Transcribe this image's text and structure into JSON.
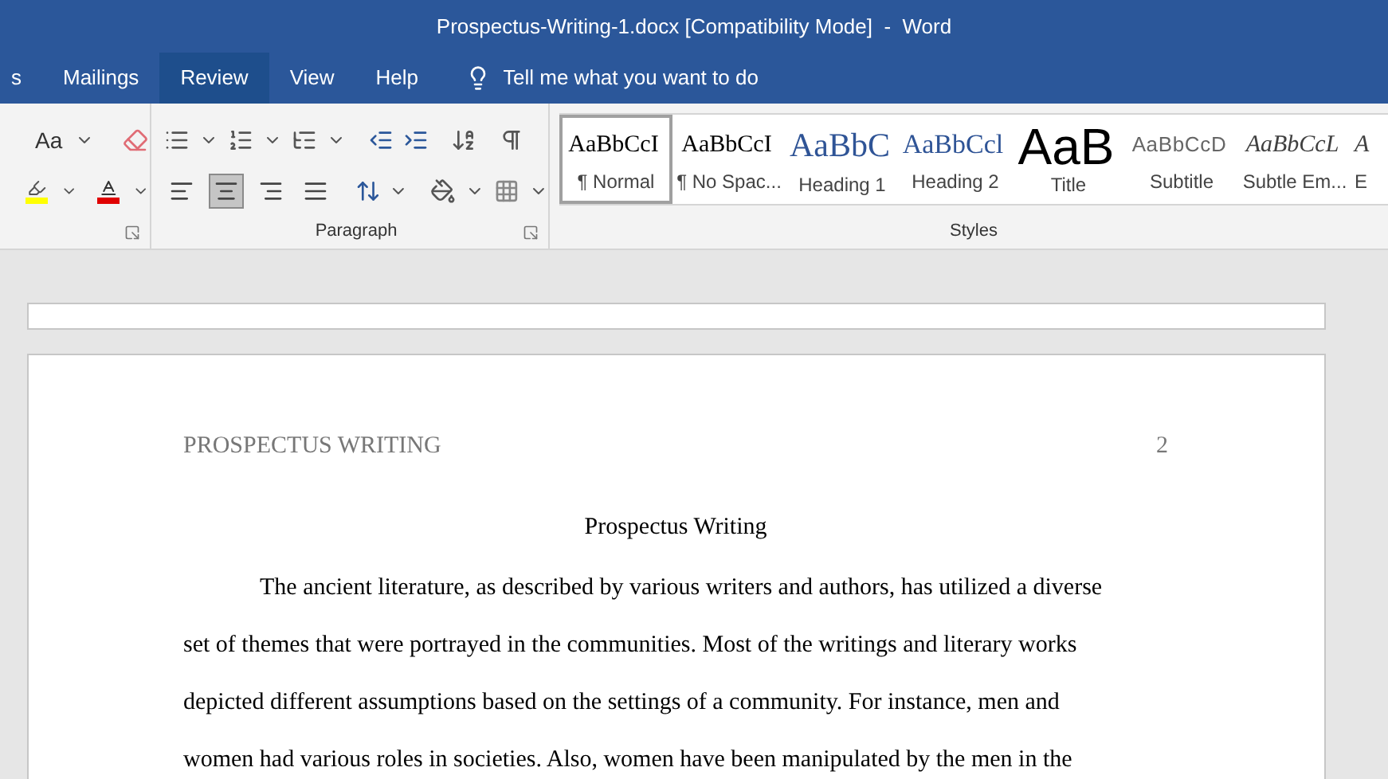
{
  "window": {
    "title": "Prospectus-Writing-1.docx [Compatibility Mode]  -  Word"
  },
  "tabs": [
    {
      "label": "s",
      "selected": false
    },
    {
      "label": "Mailings",
      "selected": false
    },
    {
      "label": "Review",
      "selected": true
    },
    {
      "label": "View",
      "selected": false
    },
    {
      "label": "Help",
      "selected": false
    }
  ],
  "tell_me": {
    "placeholder": "Tell me what you want to do"
  },
  "font_group": {
    "change_case": "Aa"
  },
  "paragraph_group": {
    "label": "Paragraph",
    "alignments": [
      {
        "kind": "left",
        "selected": false
      },
      {
        "kind": "center",
        "selected": true
      },
      {
        "kind": "right",
        "selected": false
      },
      {
        "kind": "justify",
        "selected": false
      }
    ]
  },
  "styles_group": {
    "label": "Styles",
    "styles": [
      {
        "preview": "AaBbCcI",
        "label": "¶ Normal",
        "kind": "normal",
        "selected": true
      },
      {
        "preview": "AaBbCcI",
        "label": "¶ No Spac...",
        "kind": "normal",
        "selected": false
      },
      {
        "preview": "AaBbC",
        "label": "Heading 1",
        "kind": "heading1",
        "selected": false
      },
      {
        "preview": "AaBbCcl",
        "label": "Heading 2",
        "kind": "heading2",
        "selected": false
      },
      {
        "preview": "AaB",
        "label": "Title",
        "kind": "title",
        "selected": false
      },
      {
        "preview": "AaBbCcD",
        "label": "Subtitle",
        "kind": "subtitle",
        "selected": false
      },
      {
        "preview": "AaBbCcL",
        "label": "Subtle Em...",
        "kind": "emphasis",
        "selected": false
      },
      {
        "preview": "A",
        "label": "E",
        "kind": "emphasis",
        "selected": false
      }
    ]
  },
  "document": {
    "header": "PROSPECTUS WRITING",
    "page_number": "2",
    "title": "Prospectus Writing",
    "lines": [
      "The ancient literature, as described by various writers and authors, has utilized a diverse",
      "set of themes that were portrayed in the communities. Most of the writings and literary works",
      "depicted different assumptions based on the settings of a community. For instance, men and",
      "women had various roles in societies. Also, women have been manipulated by the men in the"
    ]
  }
}
